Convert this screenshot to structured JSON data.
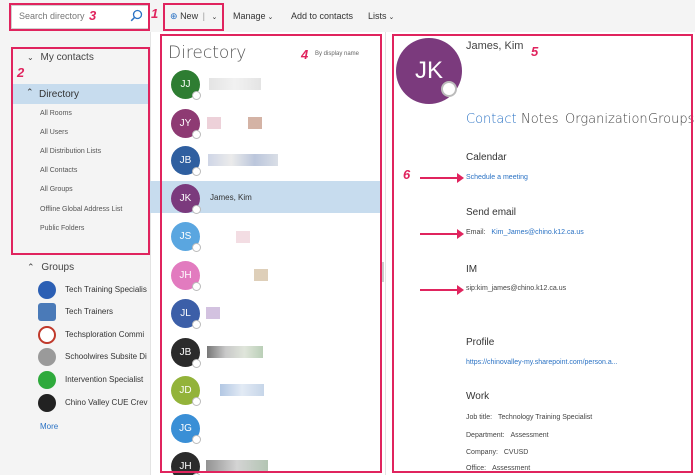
{
  "search": {
    "placeholder": "Search directory"
  },
  "toolbar": {
    "new_label": "New",
    "manage_label": "Manage",
    "add_label": "Add to contacts",
    "lists_label": "Lists"
  },
  "sidebar": {
    "my_contacts": "My contacts",
    "directory": "Directory",
    "subitems": [
      "All Rooms",
      "All Users",
      "All Distribution Lists",
      "All Contacts",
      "All Groups",
      "Offline Global Address List",
      "Public Folders"
    ],
    "groups_header": "Groups",
    "groups": [
      {
        "label": "Tech Training Specialis",
        "color": "#2b5fb4",
        "icon": "group-icon"
      },
      {
        "label": "Tech Trainers",
        "color": "#4a7ab8",
        "icon": "people-icon"
      },
      {
        "label": "Techsploration Commi",
        "color": "#c0392b",
        "icon": "logo-icon"
      },
      {
        "label": "Schoolwires Subsite Di",
        "color": "#9a9a9a",
        "icon": "globe-icon"
      },
      {
        "label": "Intervention Specialist",
        "color": "#2eaa3c",
        "icon": "group-icon"
      },
      {
        "label": "Chino Valley CUE Crev",
        "color": "#222222",
        "icon": "logo-icon"
      }
    ],
    "more": "More"
  },
  "directory": {
    "title": "Directory",
    "sort_label": "By display name",
    "contacts": [
      {
        "initials": "JJ",
        "color": "#2e7d32"
      },
      {
        "initials": "JY",
        "color": "#8e3a73"
      },
      {
        "initials": "JB",
        "color": "#2f5fa0"
      },
      {
        "initials": "JK",
        "color": "#7b3a7d",
        "name": "James, Kim"
      },
      {
        "initials": "JS",
        "color": "#5aa6e0"
      },
      {
        "initials": "JH",
        "color": "#e27bbf"
      },
      {
        "initials": "JL",
        "color": "#3c5fa8"
      },
      {
        "initials": "JB",
        "color": "#2b2b2b"
      },
      {
        "initials": "JD",
        "color": "#93b33a"
      },
      {
        "initials": "JG",
        "color": "#3a8fd6"
      },
      {
        "initials": "JH",
        "color": "#2b2b2b"
      }
    ]
  },
  "profile": {
    "initials": "JK",
    "name": "James, Kim",
    "tabs": [
      "Contact",
      "Notes",
      "Organization",
      "Groups"
    ],
    "calendar": {
      "heading": "Calendar",
      "link": "Schedule a meeting"
    },
    "email": {
      "heading": "Send email",
      "label": "Email:",
      "value": "Kim_James@chino.k12.ca.us"
    },
    "im": {
      "heading": "IM",
      "value": "sip:kim_james@chino.k12.ca.us"
    },
    "profile": {
      "heading": "Profile",
      "link": "https://chinovalley-my.sharepoint.com/person.a..."
    },
    "work": {
      "heading": "Work",
      "job_label": "Job title:",
      "job_value": "Technology Training Specialist",
      "dept_label": "Department:",
      "dept_value": "Assessment",
      "company_label": "Company:",
      "company_value": "CVUSD",
      "office_label": "Office:",
      "office_value": "Assessment"
    }
  },
  "annotations": [
    "1",
    "2",
    "3",
    "4",
    "5",
    "6"
  ],
  "colors": {
    "annotation": "#e0245e",
    "selection": "#c7dcee",
    "link": "#2a72c4"
  }
}
